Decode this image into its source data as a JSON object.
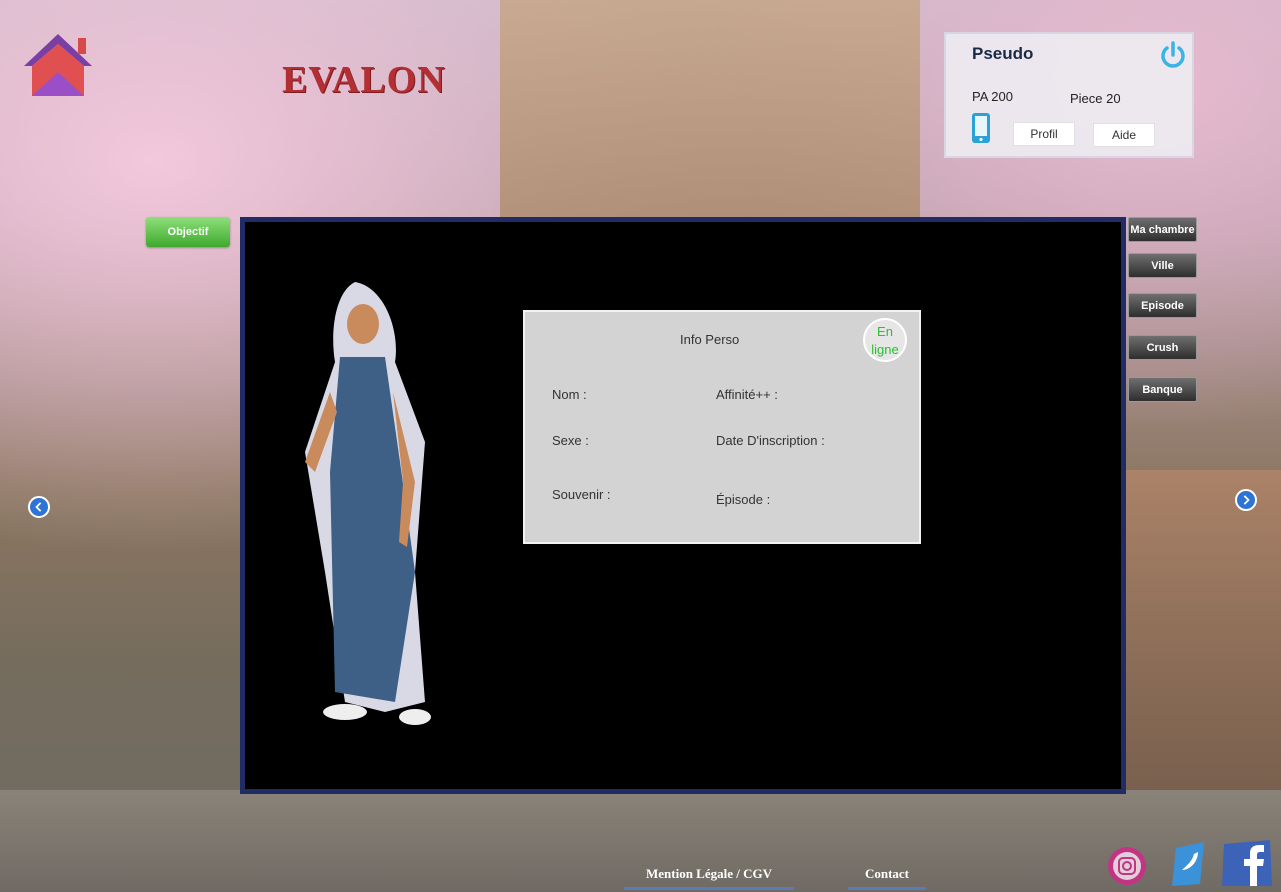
{
  "header": {
    "title": "EVALON",
    "home_icon": "house-icon"
  },
  "user_panel": {
    "pseudo": "Pseudo",
    "pa": "PA 200",
    "piece": "Piece 20",
    "profil": "Profil",
    "aide": "Aide",
    "power_icon": "power-icon",
    "phone_icon": "phone-icon"
  },
  "objectif": "Objectif",
  "info": {
    "title": "Info Perso",
    "status_line1": "En",
    "status_line2": "ligne",
    "nom": "Nom :",
    "affinite": "Affinité++ :",
    "sexe": "Sexe :",
    "date": "Date D'inscription :",
    "souvenir": "Souvenir :",
    "episode": "Épisode :"
  },
  "side_menu": [
    "Ma chambre",
    "Ville",
    "Episode",
    "Crush",
    "Banque"
  ],
  "footer": {
    "mention": "Mention Légale / CGV",
    "contact": "Contact"
  },
  "social": [
    "instagram-icon",
    "twitter-icon",
    "facebook-icon"
  ],
  "colors": {
    "title": "#b32f34",
    "frame": "#1f2c66",
    "online": "#29c22c",
    "objectif": "#3ea92f"
  }
}
